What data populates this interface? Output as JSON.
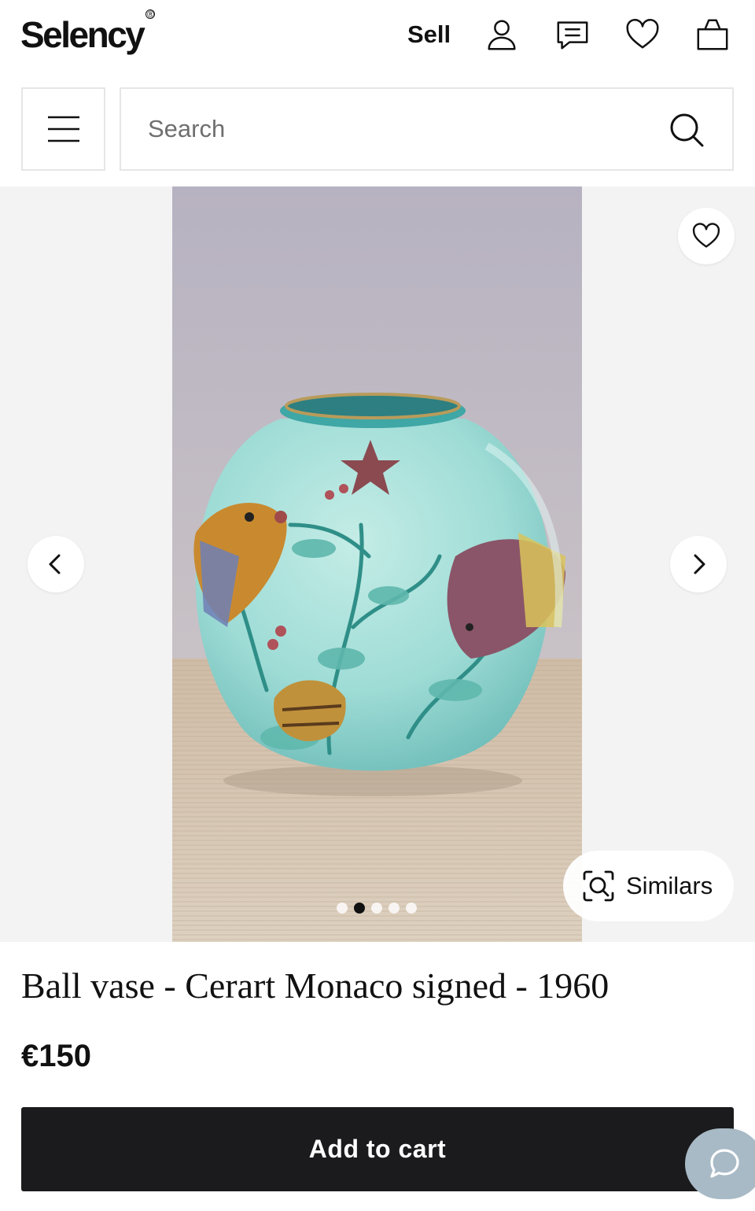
{
  "header": {
    "logo": "Selency",
    "logo_mark": "®",
    "sell_label": "Sell",
    "icons": [
      "account-icon",
      "messages-icon",
      "favorites-icon",
      "cart-icon"
    ]
  },
  "search": {
    "placeholder": "Search",
    "value": ""
  },
  "gallery": {
    "image_count": 5,
    "active_index": 1,
    "similars_label": "Similars"
  },
  "product": {
    "title": "Ball vase - Cerart Monaco signed - 1960",
    "price": "€150",
    "cart_label": "Add to cart"
  },
  "colors": {
    "primary_button": "#1b1b1d",
    "chat_fab": "#a8bac6",
    "gallery_bg": "#f3f3f3",
    "border": "#e6e6e6"
  }
}
